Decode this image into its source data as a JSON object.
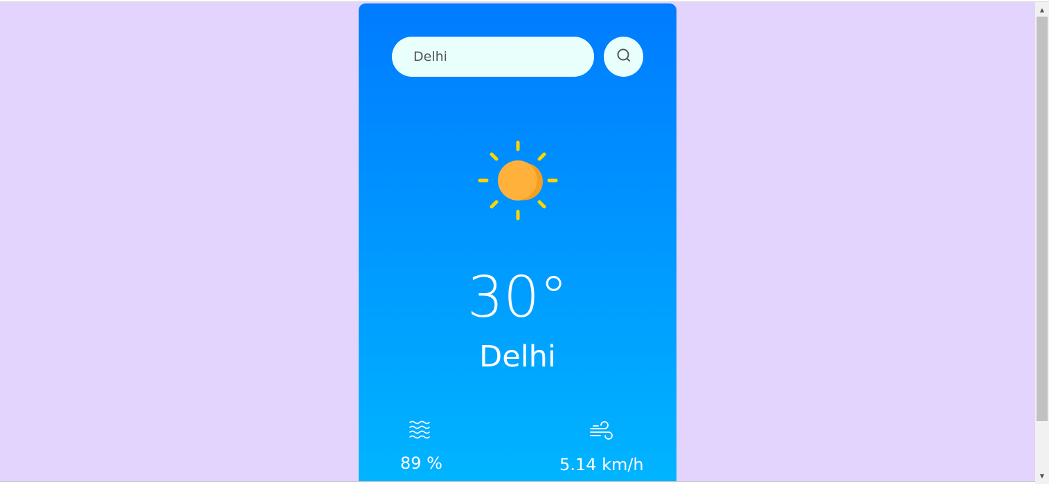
{
  "search": {
    "value": "Delhi"
  },
  "weather": {
    "temperature": "30°",
    "city": "Delhi",
    "condition_icon": "sun-icon"
  },
  "stats": {
    "humidity": "89 %",
    "humidity_icon": "humidity-waves-icon",
    "wind": "5.14 km/h",
    "wind_icon": "wind-icon"
  },
  "colors": {
    "page_background": "#e2d4fc",
    "card_gradient_top": "#007bff",
    "card_gradient_bottom": "#00b5ff",
    "input_background": "#e9fffb",
    "sun_core": "#ffb13b",
    "sun_rays": "#ffd500"
  }
}
